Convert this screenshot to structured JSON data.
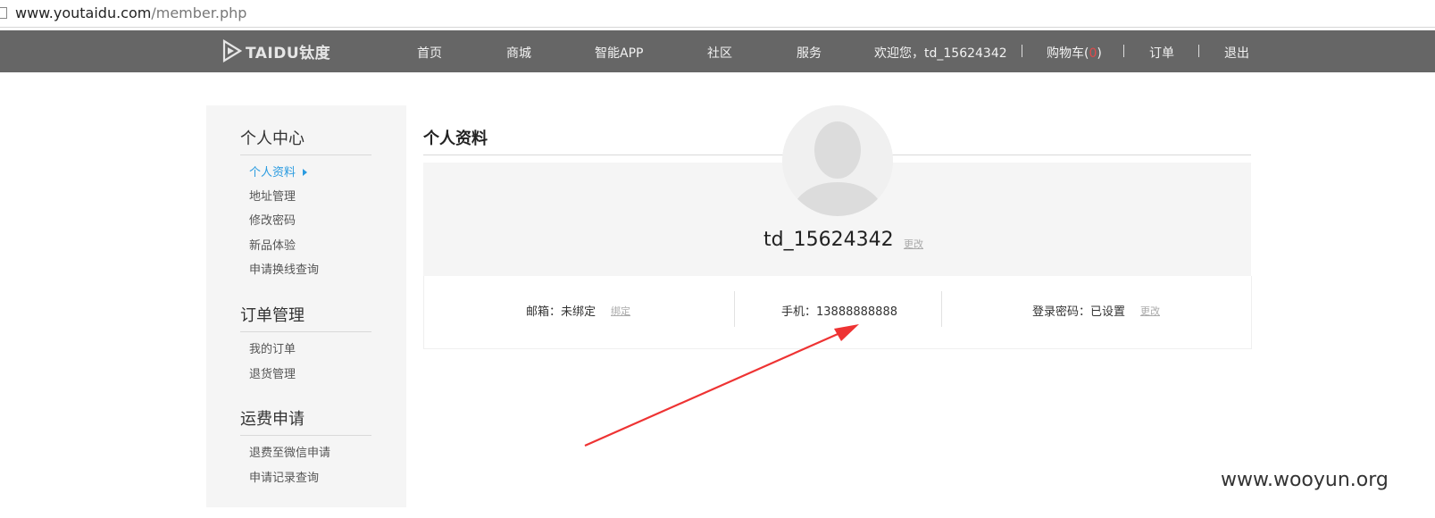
{
  "browser": {
    "url_host": "www.youtaidu.com",
    "url_path": "/member.php"
  },
  "header": {
    "logo_text": "TAIDU钛度",
    "nav": {
      "home": "首页",
      "mall": "商城",
      "app": "智能APP",
      "community": "社区",
      "service": "服务",
      "welcome": "欢迎您，td_15624342",
      "cart_label": "购物车(",
      "cart_count": "0",
      "cart_close": ")",
      "orders": "订单",
      "logout": "退出"
    },
    "cart_count_color": "#e24a4a"
  },
  "sidebar": {
    "groups": [
      {
        "title": "个人中心",
        "items": [
          "个人资料",
          "地址管理",
          "修改密码",
          "新品体验",
          "申请换线查询"
        ]
      },
      {
        "title": "订单管理",
        "items": [
          "我的订单",
          "退货管理"
        ]
      },
      {
        "title": "运费申请",
        "items": [
          "退费至微信申请",
          "申请记录查询"
        ]
      }
    ],
    "active_item": "个人资料",
    "active_color": "#2a9be0"
  },
  "main": {
    "title": "个人资料",
    "username": "td_15624342",
    "edit_label": "更改",
    "email_text": "邮箱：未绑定",
    "email_action": "绑定",
    "phone_text": "手机：13888888888",
    "password_text": "登录密码：已设置",
    "password_action": "更改"
  },
  "annotation": {
    "arrow_color": "#ee3333"
  },
  "watermark": "www.wooyun.org"
}
